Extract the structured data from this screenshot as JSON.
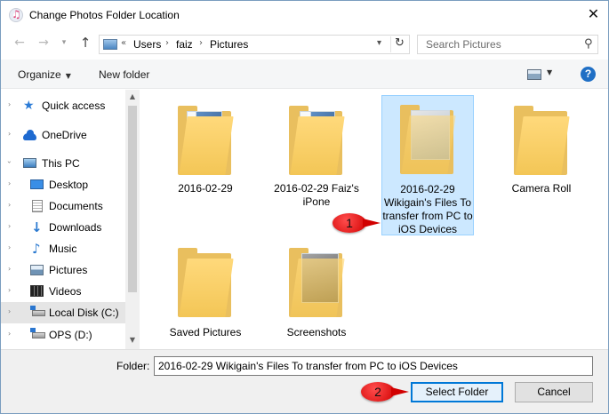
{
  "window": {
    "title": "Change Photos Folder Location",
    "close_glyph": "✕"
  },
  "address_bar": {
    "overflow": "«",
    "crumbs": [
      "Users",
      "faiz",
      "Pictures"
    ],
    "separator": "›",
    "refresh_glyph": "↻",
    "dropdown_glyph": "▾"
  },
  "search": {
    "placeholder": "Search Pictures",
    "icon_glyph": "⚲"
  },
  "nav_buttons": {
    "back": "←",
    "forward": "→",
    "recent": "▾",
    "up": "↑"
  },
  "toolbar": {
    "organize_label": "Organize",
    "organize_caret": "▼",
    "new_folder_label": "New folder",
    "view_caret": "▼",
    "help_label": "?"
  },
  "nav_pane": {
    "items": [
      {
        "label": "Quick access",
        "icon": "star-icon",
        "glyph": "★"
      },
      {
        "label": "OneDrive",
        "icon": "cloud-icon",
        "glyph": ""
      },
      {
        "label": "This PC",
        "icon": "computer-icon",
        "glyph": ""
      },
      {
        "label": "Desktop",
        "icon": "desktop-icon",
        "glyph": ""
      },
      {
        "label": "Documents",
        "icon": "documents-icon",
        "glyph": ""
      },
      {
        "label": "Downloads",
        "icon": "downloads-icon",
        "glyph": "↓"
      },
      {
        "label": "Music",
        "icon": "music-icon",
        "glyph": "♪"
      },
      {
        "label": "Pictures",
        "icon": "pictures-icon",
        "glyph": ""
      },
      {
        "label": "Videos",
        "icon": "videos-icon",
        "glyph": ""
      },
      {
        "label": "Local Disk (C:)",
        "icon": "disk-icon",
        "glyph": ""
      },
      {
        "label": "OPS (D:)",
        "icon": "disk-icon",
        "glyph": ""
      }
    ],
    "expander_glyph": "›",
    "scroll_up": "▲",
    "scroll_down": "▼"
  },
  "content": {
    "folders": [
      {
        "label": "2016-02-29"
      },
      {
        "label": "2016-02-29 Faiz's iPone"
      },
      {
        "label": "2016-02-29 Wikigain's Files To transfer from PC to iOS Devices"
      },
      {
        "label": "Camera Roll"
      },
      {
        "label": "Saved Pictures"
      },
      {
        "label": "Screenshots"
      }
    ]
  },
  "callouts": {
    "one": "1",
    "two": "2"
  },
  "footer": {
    "folder_label": "Folder:",
    "folder_value": "2016-02-29 Wikigain's Files To transfer from PC to iOS Devices",
    "select_button": "Select Folder",
    "cancel_button": "Cancel"
  },
  "colors": {
    "accent": "#0078d7",
    "selection": "#cce8ff",
    "folder": "#f3c656",
    "callout": "#d10000"
  }
}
